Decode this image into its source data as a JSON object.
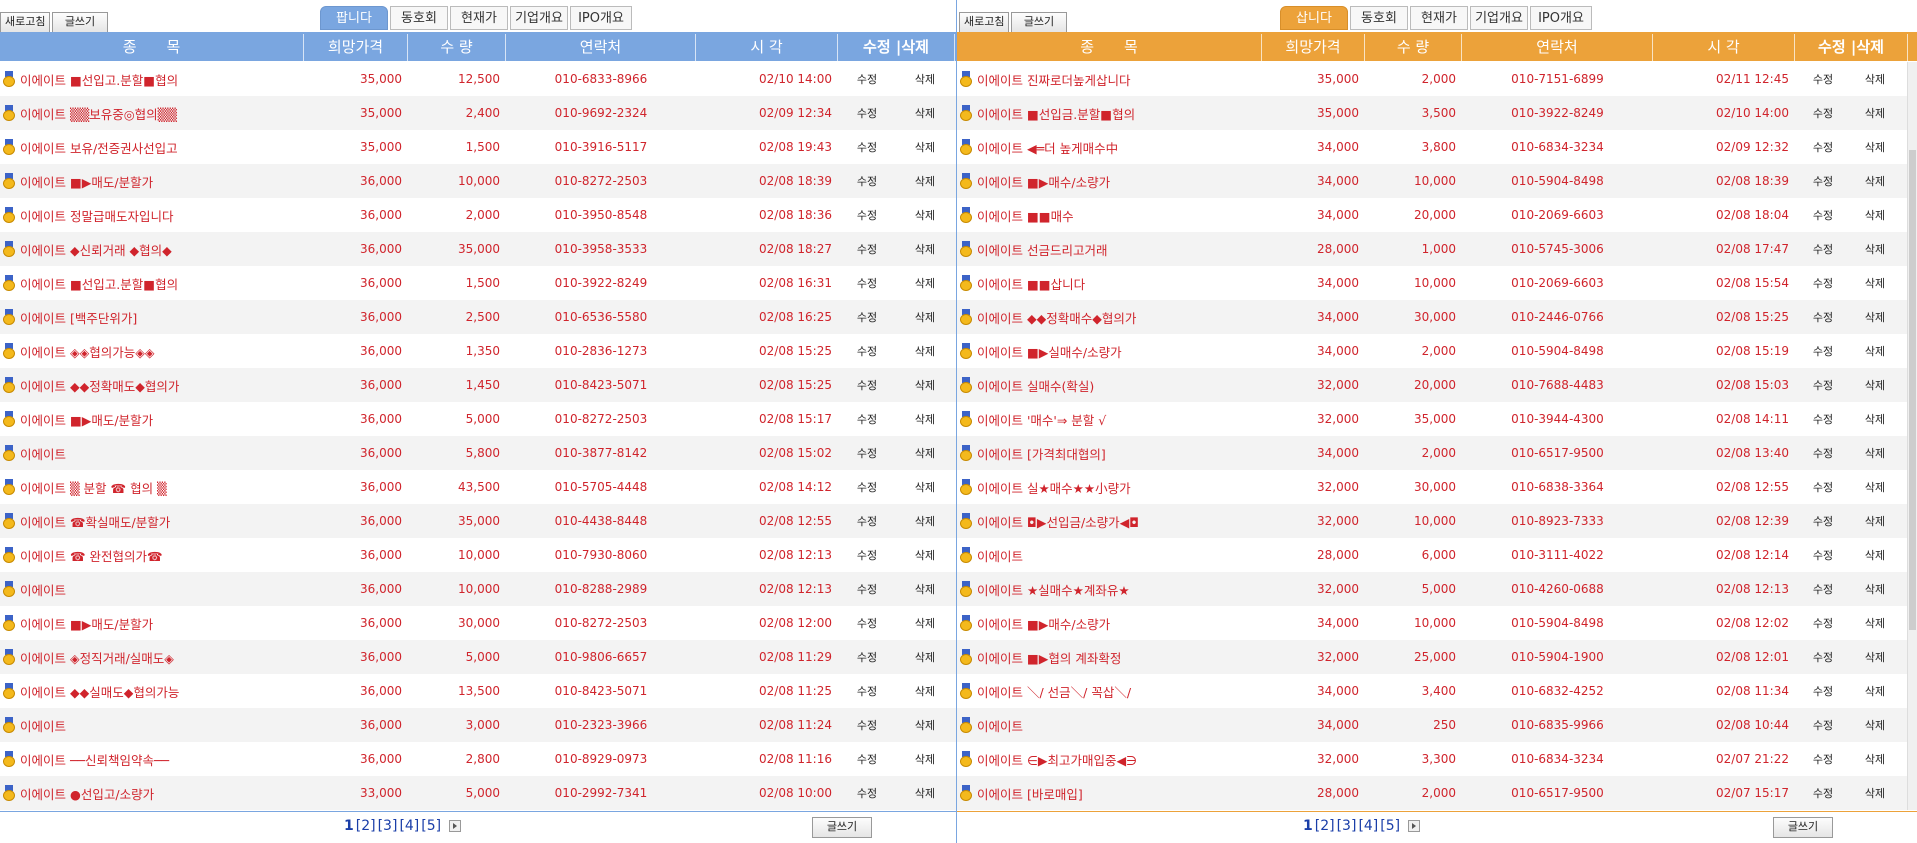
{
  "sell": {
    "refresh_label": "새로고침",
    "write_label": "글쓰기",
    "tabs": [
      "팝니다",
      "동호회",
      "현재가",
      "기업개요",
      "IPO개요"
    ],
    "columns": [
      "종　　목",
      "희망가격",
      "수 량",
      "연락처",
      "시 각",
      "수정 |삭제"
    ],
    "rows": [
      {
        "title": "이에이트 ■선입고.분할■협의",
        "price": "35,000",
        "qty": "12,500",
        "phone": "010-6833-8966",
        "time": "02/10 14:00"
      },
      {
        "title": "이에이트 ▒▒보유중◎협의▒▒",
        "price": "35,000",
        "qty": "2,400",
        "phone": "010-9692-2324",
        "time": "02/09 12:34"
      },
      {
        "title": "이에이트 보유/전증권사선입고",
        "price": "35,000",
        "qty": "1,500",
        "phone": "010-3916-5117",
        "time": "02/08 19:43"
      },
      {
        "title": "이에이트 ■▶매도/분할가",
        "price": "36,000",
        "qty": "10,000",
        "phone": "010-8272-2503",
        "time": "02/08 18:39"
      },
      {
        "title": "이에이트 정말급매도자입니다",
        "price": "36,000",
        "qty": "2,000",
        "phone": "010-3950-8548",
        "time": "02/08 18:36"
      },
      {
        "title": "이에이트 ◆신뢰거래 ◆협의◆",
        "price": "36,000",
        "qty": "35,000",
        "phone": "010-3958-3533",
        "time": "02/08 18:27"
      },
      {
        "title": "이에이트 ■선입고.분할■협의",
        "price": "36,000",
        "qty": "1,500",
        "phone": "010-3922-8249",
        "time": "02/08 16:31"
      },
      {
        "title": "이에이트 [백주단위가]",
        "price": "36,000",
        "qty": "2,500",
        "phone": "010-6536-5580",
        "time": "02/08 16:25"
      },
      {
        "title": "이에이트 ◈◈협의가능◈◈",
        "price": "36,000",
        "qty": "1,350",
        "phone": "010-2836-1273",
        "time": "02/08 15:25"
      },
      {
        "title": "이에이트 ◆◆정확매도◆협의가",
        "price": "36,000",
        "qty": "1,450",
        "phone": "010-8423-5071",
        "time": "02/08 15:25"
      },
      {
        "title": "이에이트 ■▶매도/분할가",
        "price": "36,000",
        "qty": "5,000",
        "phone": "010-8272-2503",
        "time": "02/08 15:17"
      },
      {
        "title": "이에이트",
        "price": "36,000",
        "qty": "5,800",
        "phone": "010-3877-8142",
        "time": "02/08 15:02"
      },
      {
        "title": "이에이트 ▒ 분할 ☎ 협의 ▒",
        "price": "36,000",
        "qty": "43,500",
        "phone": "010-5705-4448",
        "time": "02/08 14:12"
      },
      {
        "title": "이에이트 ☎확실매도/분할가",
        "price": "36,000",
        "qty": "35,000",
        "phone": "010-4438-8448",
        "time": "02/08 12:55"
      },
      {
        "title": "이에이트 ☎ 완전협의가☎",
        "price": "36,000",
        "qty": "10,000",
        "phone": "010-7930-8060",
        "time": "02/08 12:13"
      },
      {
        "title": "이에이트",
        "price": "36,000",
        "qty": "10,000",
        "phone": "010-8288-2989",
        "time": "02/08 12:13"
      },
      {
        "title": "이에이트 ■▶매도/분할가",
        "price": "36,000",
        "qty": "30,000",
        "phone": "010-8272-2503",
        "time": "02/08 12:00"
      },
      {
        "title": "이에이트 ◈정직거래/실매도◈",
        "price": "36,000",
        "qty": "5,000",
        "phone": "010-9806-6657",
        "time": "02/08 11:29"
      },
      {
        "title": "이에이트 ◆◆실매도◆협의가능",
        "price": "36,000",
        "qty": "13,500",
        "phone": "010-8423-5071",
        "time": "02/08 11:25"
      },
      {
        "title": "이에이트",
        "price": "36,000",
        "qty": "3,000",
        "phone": "010-2323-3966",
        "time": "02/08 11:24"
      },
      {
        "title": "이에이트 ──신뢰책임약속──",
        "price": "36,000",
        "qty": "2,800",
        "phone": "010-8929-0973",
        "time": "02/08 11:16"
      },
      {
        "title": "이에이트 ●선입고/소량가",
        "price": "33,000",
        "qty": "5,000",
        "phone": "010-2992-7341",
        "time": "02/08 10:00"
      }
    ],
    "edit_label": "수정",
    "delete_label": "삭제",
    "pager": {
      "current": "1",
      "pages": [
        "[2]",
        "[3]",
        "[4]",
        "[5]"
      ]
    }
  },
  "buy": {
    "refresh_label": "새로고침",
    "write_label": "글쓰기",
    "tabs": [
      "삽니다",
      "동호회",
      "현재가",
      "기업개요",
      "IPO개요"
    ],
    "columns": [
      "종　　목",
      "희망가격",
      "수 량",
      "연락처",
      "시 각",
      "수정 |삭제"
    ],
    "rows": [
      {
        "title": "이에이트 진짜로더높게삽니다",
        "price": "35,000",
        "qty": "2,000",
        "phone": "010-7151-6899",
        "time": "02/11 12:45"
      },
      {
        "title": "이에이트 ■선입금.분할■협의",
        "price": "35,000",
        "qty": "3,500",
        "phone": "010-3922-8249",
        "time": "02/10 14:00"
      },
      {
        "title": "이에이트 ◀═더 높게매수中",
        "price": "34,000",
        "qty": "3,800",
        "phone": "010-6834-3234",
        "time": "02/09 12:32"
      },
      {
        "title": "이에이트 ■▶매수/소량가",
        "price": "34,000",
        "qty": "10,000",
        "phone": "010-5904-8498",
        "time": "02/08 18:39"
      },
      {
        "title": "이에이트 ■■매수",
        "price": "34,000",
        "qty": "20,000",
        "phone": "010-2069-6603",
        "time": "02/08 18:04"
      },
      {
        "title": "이에이트 선금드리고거래",
        "price": "28,000",
        "qty": "1,000",
        "phone": "010-5745-3006",
        "time": "02/08 17:47"
      },
      {
        "title": "이에이트 ■■삽니다",
        "price": "34,000",
        "qty": "10,000",
        "phone": "010-2069-6603",
        "time": "02/08 15:54"
      },
      {
        "title": "이에이트 ◆◆정확매수◆협의가",
        "price": "34,000",
        "qty": "30,000",
        "phone": "010-2446-0766",
        "time": "02/08 15:25"
      },
      {
        "title": "이에이트 ■▶실매수/소량가",
        "price": "34,000",
        "qty": "2,000",
        "phone": "010-5904-8498",
        "time": "02/08 15:19"
      },
      {
        "title": "이에이트 실매수(확실)",
        "price": "32,000",
        "qty": "20,000",
        "phone": "010-7688-4483",
        "time": "02/08 15:03"
      },
      {
        "title": "이에이트 '매수'⇒ 분할 √",
        "price": "32,000",
        "qty": "35,000",
        "phone": "010-3944-4300",
        "time": "02/08 14:11"
      },
      {
        "title": "이에이트 [가격최대협의]",
        "price": "34,000",
        "qty": "2,000",
        "phone": "010-6517-9500",
        "time": "02/08 13:40"
      },
      {
        "title": "이에이트 실★매수★★小량가",
        "price": "32,000",
        "qty": "30,000",
        "phone": "010-6838-3364",
        "time": "02/08 12:55"
      },
      {
        "title": "이에이트 ◘▶선입금/소량가◀◘",
        "price": "32,000",
        "qty": "10,000",
        "phone": "010-8923-7333",
        "time": "02/08 12:39"
      },
      {
        "title": "이에이트",
        "price": "28,000",
        "qty": "6,000",
        "phone": "010-3111-4022",
        "time": "02/08 12:14"
      },
      {
        "title": "이에이트 ★실매수★계좌유★",
        "price": "32,000",
        "qty": "5,000",
        "phone": "010-4260-0688",
        "time": "02/08 12:13"
      },
      {
        "title": "이에이트 ■▶매수/소량가",
        "price": "34,000",
        "qty": "10,000",
        "phone": "010-5904-8498",
        "time": "02/08 12:02"
      },
      {
        "title": "이에이트 ■▶협의 계좌확정",
        "price": "32,000",
        "qty": "25,000",
        "phone": "010-5904-1900",
        "time": "02/08 12:01"
      },
      {
        "title": "이에이트 ＼/ 선금＼/ 꼭삽＼/",
        "price": "34,000",
        "qty": "3,400",
        "phone": "010-6832-4252",
        "time": "02/08 11:34"
      },
      {
        "title": "이에이트",
        "price": "34,000",
        "qty": "250",
        "phone": "010-6835-9966",
        "time": "02/08 10:44"
      },
      {
        "title": "이에이트 ∈▶최고가매입중◀∋",
        "price": "32,000",
        "qty": "3,300",
        "phone": "010-6834-3234",
        "time": "02/07 21:22"
      },
      {
        "title": "이에이트 [바로매입]",
        "price": "28,000",
        "qty": "2,000",
        "phone": "010-6517-9500",
        "time": "02/07 15:17"
      }
    ],
    "edit_label": "수정",
    "delete_label": "삭제",
    "pager": {
      "current": "1",
      "pages": [
        "[2]",
        "[3]",
        "[4]",
        "[5]"
      ]
    }
  },
  "colors": {
    "sell_accent": "#7aa6e0",
    "buy_accent": "#eca23a",
    "row_text": "#d0242c"
  }
}
